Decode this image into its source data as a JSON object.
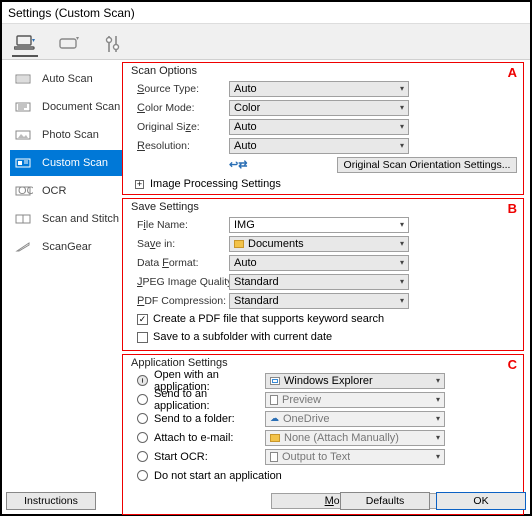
{
  "window": {
    "title": "Settings (Custom Scan)"
  },
  "sidebar": {
    "items": [
      {
        "label": "Auto Scan"
      },
      {
        "label": "Document Scan"
      },
      {
        "label": "Photo Scan"
      },
      {
        "label": "Custom Scan"
      },
      {
        "label": "OCR"
      },
      {
        "label": "Scan and Stitch"
      },
      {
        "label": "ScanGear"
      }
    ]
  },
  "sections": {
    "a": {
      "title": "Scan Options",
      "letter": "A",
      "source_type_label": "Source Type:",
      "source_type_value": "Auto",
      "color_mode_label": "Color Mode:",
      "color_mode_value": "Color",
      "original_size_label": "Original Size:",
      "original_size_value": "Auto",
      "resolution_label": "Resolution:",
      "resolution_value": "Auto",
      "orientation_btn": "Original Scan Orientation Settings...",
      "expander": "Image Processing Settings"
    },
    "b": {
      "title": "Save Settings",
      "letter": "B",
      "file_name_label": "File Name:",
      "file_name_value": "IMG",
      "save_in_label": "Save in:",
      "save_in_value": "Documents",
      "data_format_label": "Data Format:",
      "data_format_value": "Auto",
      "jpeg_quality_label": "JPEG Image Quality:",
      "jpeg_quality_value": "Standard",
      "pdf_compression_label": "PDF Compression:",
      "pdf_compression_value": "Standard",
      "chk_pdf": "Create a PDF file that supports keyword search",
      "chk_subfolder": "Save to a subfolder with current date"
    },
    "c": {
      "title": "Application Settings",
      "letter": "C",
      "open_app_label": "Open with an application:",
      "open_app_value": "Windows Explorer",
      "send_app_label": "Send to an application:",
      "send_app_value": "Preview",
      "send_folder_label": "Send to a folder:",
      "send_folder_value": "OneDrive",
      "attach_email_label": "Attach to e-mail:",
      "attach_email_value": "None (Attach Manually)",
      "start_ocr_label": "Start OCR:",
      "start_ocr_value": "Output to Text",
      "do_not_start": "Do not start an application",
      "more_functions": "More Functions"
    }
  },
  "bottom": {
    "instructions": "Instructions",
    "defaults": "Defaults",
    "ok": "OK"
  }
}
